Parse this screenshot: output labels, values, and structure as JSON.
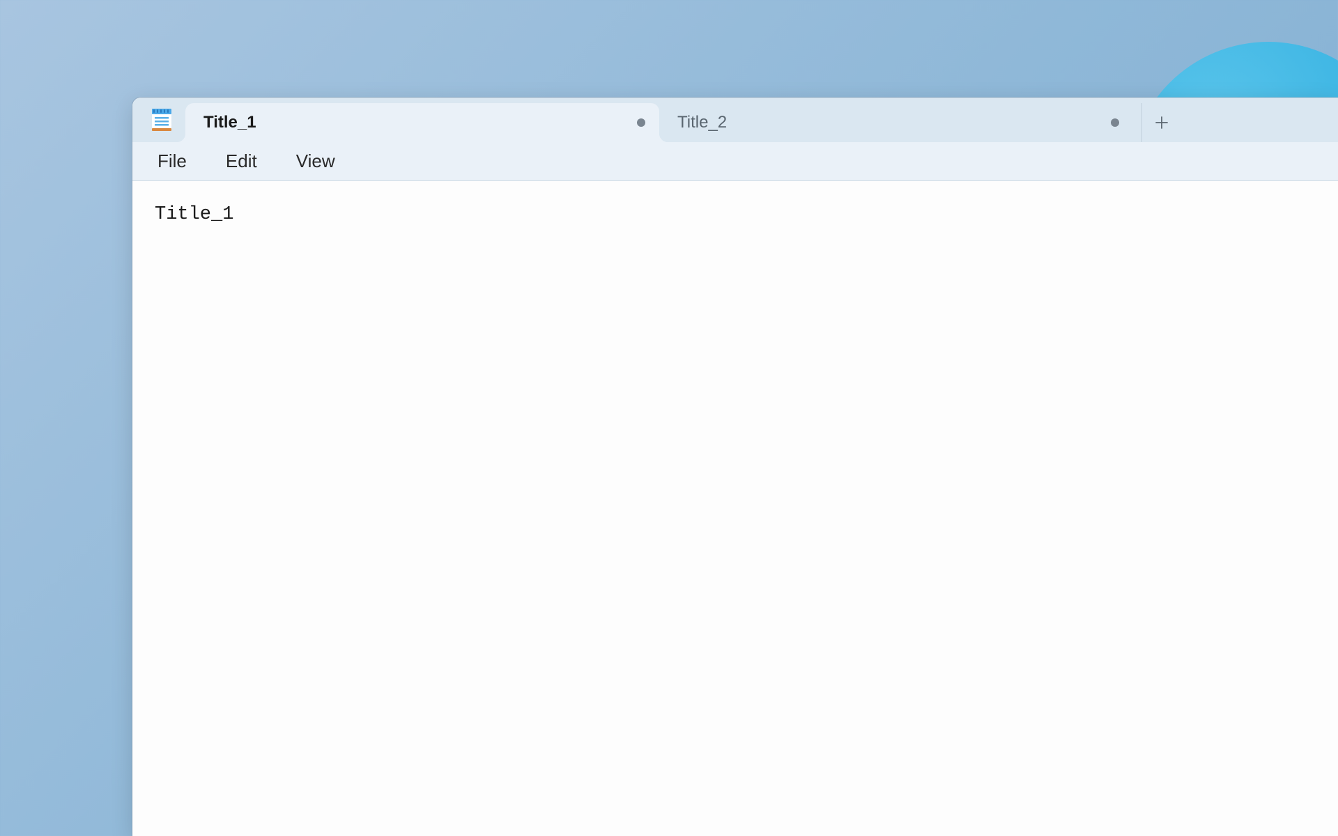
{
  "app": {
    "name": "Notepad"
  },
  "tabs": [
    {
      "label": "Title_1",
      "active": true,
      "modified": true
    },
    {
      "label": "Title_2",
      "active": false,
      "modified": true
    }
  ],
  "menubar": {
    "items": [
      {
        "label": "File"
      },
      {
        "label": "Edit"
      },
      {
        "label": "View"
      }
    ]
  },
  "editor": {
    "content": "Title_1"
  }
}
